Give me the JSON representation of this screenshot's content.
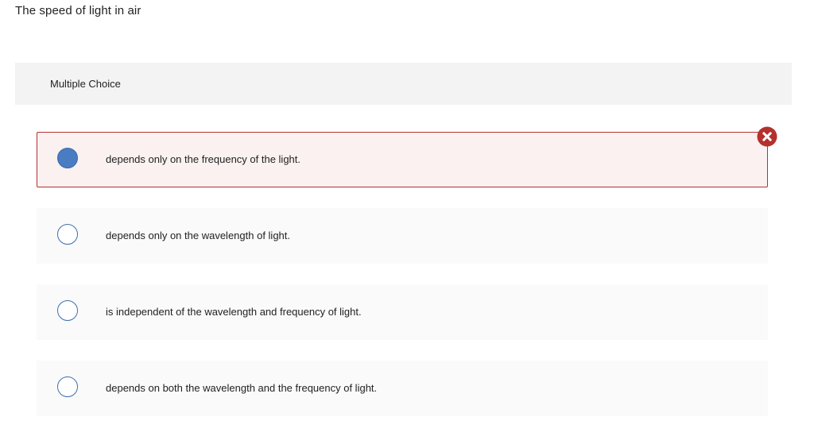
{
  "question": {
    "prompt": "The speed of light in air",
    "type_label": "Multiple Choice"
  },
  "choices": [
    {
      "label": "depends only on the frequency of the light.",
      "selected": true,
      "status": "incorrect"
    },
    {
      "label": "depends only on the wavelength of light.",
      "selected": false
    },
    {
      "label": "is independent of the wavelength and frequency of light.",
      "selected": false
    },
    {
      "label": "depends on both the wavelength and the frequency of light.",
      "selected": false
    }
  ],
  "icons": {
    "wrong_indicator": "close-circle-icon"
  },
  "colors": {
    "incorrect_red": "#b4312d",
    "radio_blue": "#4a7cc2",
    "incorrect_bg": "#fbf1f1"
  }
}
